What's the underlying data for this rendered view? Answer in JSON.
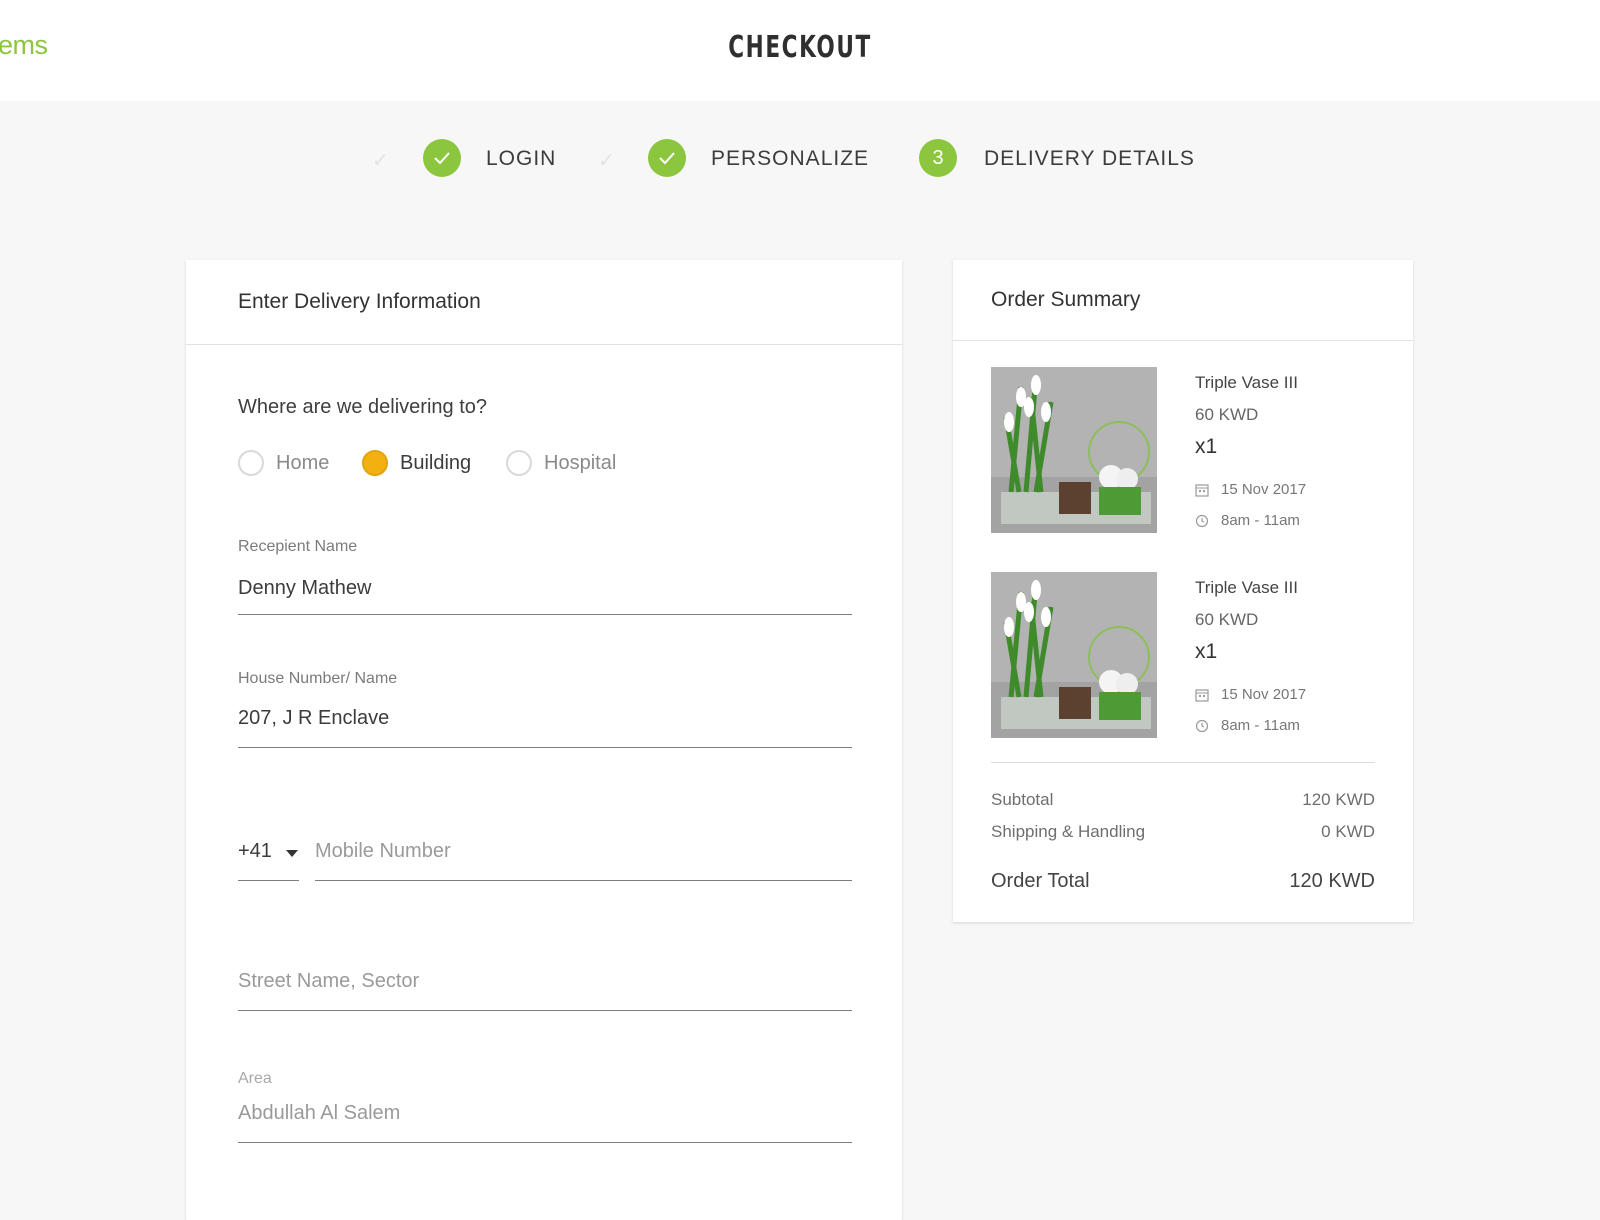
{
  "header": {
    "logo_fragment": "ems",
    "title": "CHECKOUT"
  },
  "steps": [
    {
      "number": "",
      "label": "LOGIN",
      "status": "complete"
    },
    {
      "number": "",
      "label": "PERSONALIZE",
      "status": "complete"
    },
    {
      "number": "3",
      "label": "DELIVERY DETAILS",
      "status": "current"
    }
  ],
  "delivery": {
    "heading": "Enter Delivery Information",
    "question": "Where are we delivering to?",
    "options": [
      "Home",
      "Building",
      "Hospital"
    ],
    "selected": "Building",
    "recipient_label": "Recepient Name",
    "recipient_value": "Denny Mathew",
    "house_label": "House Number/ Name",
    "house_value": "207, J R Enclave",
    "country_code": "+41",
    "mobile_placeholder": "Mobile Number",
    "street_placeholder": "Street Name, Sector",
    "area_label": "Area",
    "area_value": "Abdullah Al Salem"
  },
  "summary": {
    "heading": "Order Summary",
    "items": [
      {
        "name": "Triple Vase III",
        "price": "60 KWD",
        "qty": "x1",
        "date": "15 Nov 2017",
        "time": "8am - 11am"
      },
      {
        "name": "Triple Vase III",
        "price": "60 KWD",
        "qty": "x1",
        "date": "15 Nov 2017",
        "time": "8am - 11am"
      }
    ],
    "subtotal_label": "Subtotal",
    "subtotal_value": "120 KWD",
    "shipping_label": "Shipping & Handling",
    "shipping_value": "0 KWD",
    "total_label": "Order Total",
    "total_value": "120 KWD"
  },
  "colors": {
    "brand_green": "#8cc63f",
    "radio_selected": "#f2b011",
    "background": "#f7f7f7"
  }
}
